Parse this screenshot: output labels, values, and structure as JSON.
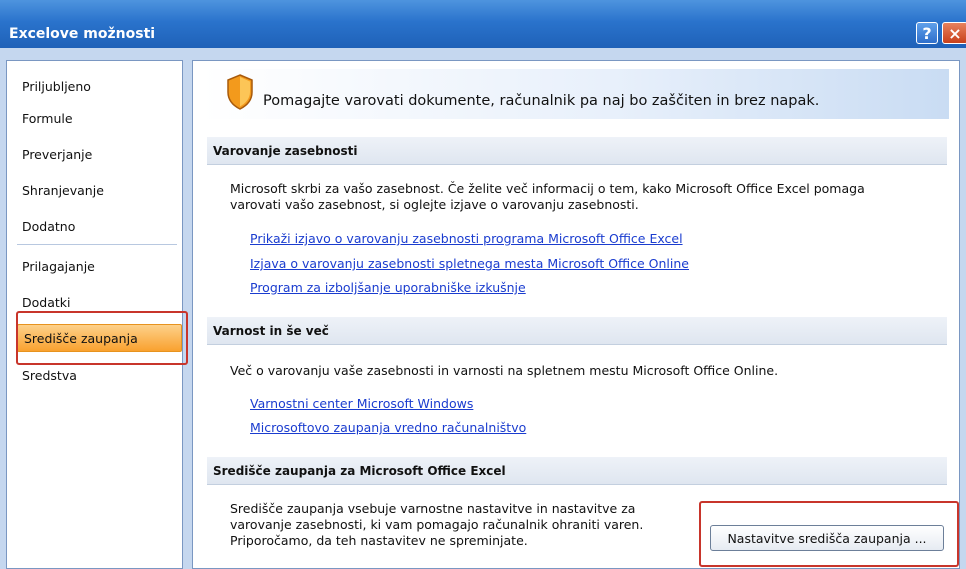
{
  "window": {
    "title": "Excelove možnosti",
    "help_label": "?",
    "close_label": "×"
  },
  "nav": {
    "items": [
      {
        "label": "Priljubljeno"
      },
      {
        "label": "Formule"
      },
      {
        "label": "Preverjanje"
      },
      {
        "label": "Shranjevanje"
      },
      {
        "label": "Dodatno"
      },
      {
        "label": "Prilagajanje"
      },
      {
        "label": "Dodatki"
      },
      {
        "label": "Središče zaupanja"
      },
      {
        "label": "Sredstva"
      }
    ],
    "selected_index": 7
  },
  "content": {
    "banner_text": "Pomagajte varovati dokumente, računalnik pa naj bo zaščiten in brez napak.",
    "sections": [
      {
        "header": "Varovanje zasebnosti",
        "paragraph_lines": [
          "Microsoft skrbi za vašo zasebnost. Če želite več informacij o tem, kako Microsoft Office Excel pomaga",
          "varovati vašo zasebnost, si oglejte izjave o varovanju zasebnosti."
        ],
        "links": [
          "Prikaži izjavo o varovanju zasebnosti programa Microsoft Office Excel",
          "Izjava o varovanju zasebnosti spletnega mesta Microsoft Office Online",
          "Program za izboljšanje uporabniške izkušnje"
        ]
      },
      {
        "header": "Varnost in še več",
        "paragraph_lines": [
          "Več o varovanju vaše zasebnosti in varnosti na spletnem mestu Microsoft Office Online."
        ],
        "links": [
          "Varnostni center Microsoft Windows",
          "Microsoftovo zaupanja vredno računalništvo"
        ]
      },
      {
        "header": "Središče zaupanja za Microsoft Office Excel",
        "paragraph_lines": [
          "Središče zaupanja vsebuje varnostne nastavitve in nastavitve za",
          "varovanje zasebnosti, ki vam pomagajo računalnik ohraniti varen.",
          "Priporočamo, da teh nastavitev ne spreminjate."
        ],
        "button_label": "Nastavitve središča zaupanja ..."
      }
    ]
  },
  "colors": {
    "titlebar": "#2a73cc",
    "selected_nav": "#f9a12f",
    "link": "#1a3ccf",
    "highlight_box": "#c8352b"
  },
  "icons": {
    "banner": "shield-icon",
    "help": "help-icon",
    "close": "close-icon"
  }
}
